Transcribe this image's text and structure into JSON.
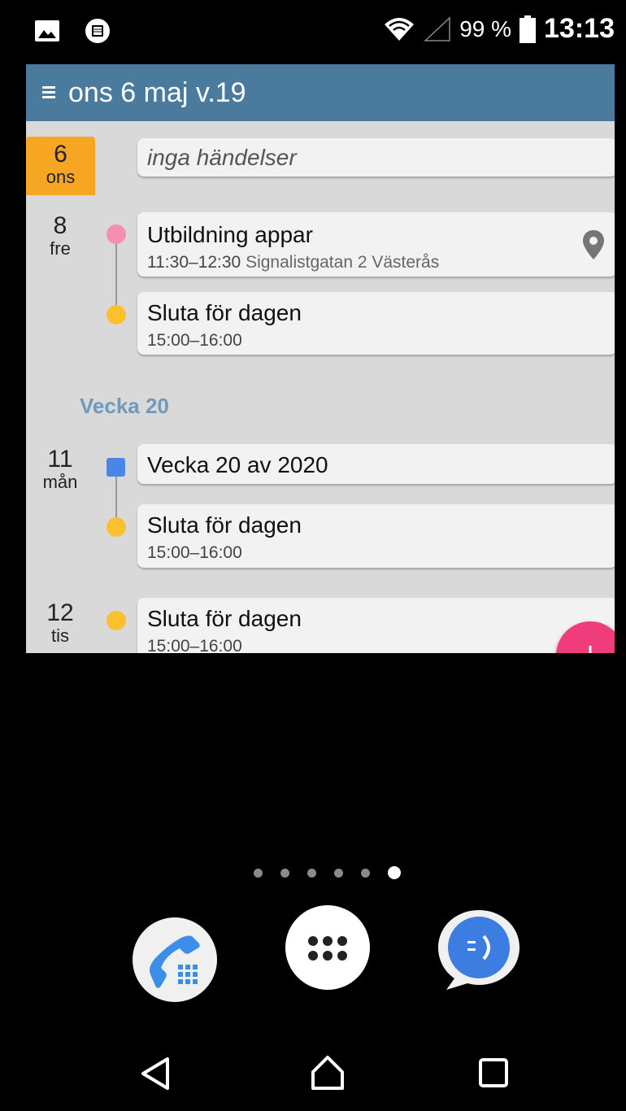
{
  "statusbar": {
    "left_icons": [
      "image-icon",
      "app-notification-icon"
    ],
    "wifi": "wifi-icon",
    "signal": "signal-icon",
    "battery_percent": "99 %",
    "time": "13:13"
  },
  "widget": {
    "header_title": "ons 6 maj v.19",
    "colors": {
      "header": "#4a7a9c",
      "today": "#f6a623",
      "fab": "#f03c7a"
    },
    "days": [
      {
        "num": "6",
        "weekday": "ons",
        "today": true
      },
      {
        "num": "8",
        "weekday": "fre"
      },
      {
        "num": "11",
        "weekday": "mån"
      },
      {
        "num": "12",
        "weekday": "tis"
      }
    ],
    "no_events": "inga händelser",
    "events": [
      {
        "title": "Utbildning appar",
        "time": "11:30–12:30",
        "location": "Signalistgatan 2 Västerås",
        "color": "#f48fb1"
      },
      {
        "title": "Sluta för dagen",
        "time": "15:00–16:00",
        "color": "#fbc02d"
      },
      {
        "title": "Vecka 20 av 2020",
        "color": "#4a86e8"
      },
      {
        "title": "Sluta för dagen",
        "time": "15:00–16:00",
        "color": "#fbc02d"
      },
      {
        "title": "Sluta för dagen",
        "time": "15:00–16:00",
        "color": "#fbc02d"
      }
    ],
    "week_heading": "Vecka 20"
  },
  "home": {
    "page_dots": 6,
    "active_page": 6,
    "dock": [
      "phone-icon",
      "app-drawer-icon",
      "messaging-icon"
    ]
  },
  "navbar": [
    "back-icon",
    "home-icon",
    "recents-icon"
  ]
}
